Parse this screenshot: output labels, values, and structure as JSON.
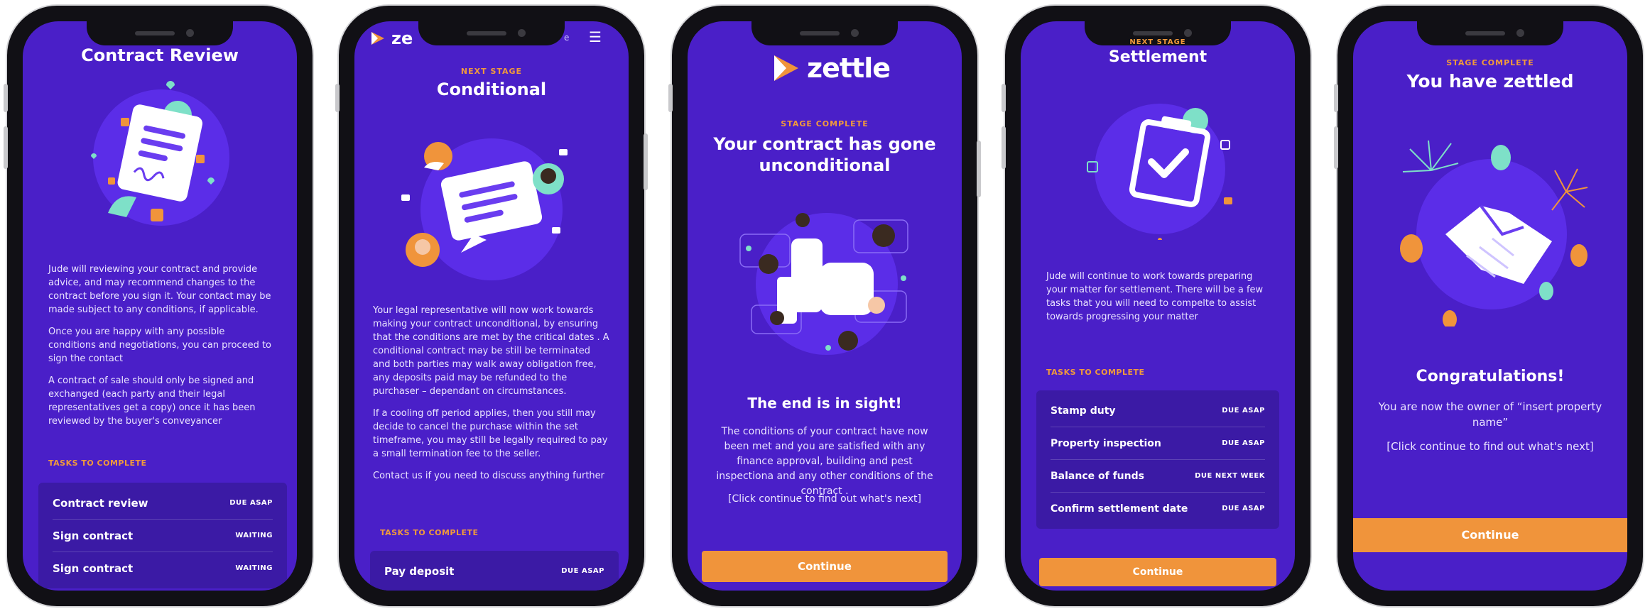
{
  "brand": {
    "name": "zettle",
    "orange": "#f0943b",
    "purple": "#4a1fc8",
    "menu_icon": "hamburger-icon"
  },
  "screens": [
    {
      "title": "Contract Review",
      "paragraphs": [
        "Jude will  reviewing your contract  and provide advice, and may recommend changes to the contract before you sign it. Your contact may be made subject to any conditions, if applicable.",
        "Once you are happy with any  possible conditions and negotiations, you can proceed to sign the contact",
        "A contract of sale should only be signed and exchanged (each party  and their legal representatives get a copy) once it has been reviewed by the buyer's  conveyancer"
      ],
      "tasks_label": "TASKS TO COMPLETE",
      "tasks": [
        {
          "name": "Contract review",
          "status": "DUE ASAP"
        },
        {
          "name": "Sign contract",
          "status": "WAITING"
        },
        {
          "name": "Sign contract",
          "status": "WAITING"
        }
      ]
    },
    {
      "header_partial_logo": "ze",
      "header_partial_text": "e",
      "eyebrow": "NEXT STAGE",
      "title": "Conditional",
      "paragraphs": [
        "Your legal representative will now work towards making your contract unconditional, by ensuring that the conditions are met by the critical dates . A conditional contract may be still be terminated and both parties may walk away obligation free, any deposits paid may be refunded to the purchaser – dependant on circumstances.",
        "If a cooling off period applies, then you still may decide to cancel the purchase within the set timeframe, you may still be legally required to pay a small termination fee to the seller.",
        "Contact us if you need to discuss anything further"
      ],
      "tasks_label": "TASKS TO COMPLETE",
      "tasks": [
        {
          "name": "Pay deposit",
          "status": "DUE ASAP"
        }
      ]
    },
    {
      "eyebrow": "STAGE COMPLETE",
      "title": "Your contract has gone unconditional",
      "subtitle": "The end is in sight!",
      "paragraph": "The conditions of your contract have now been met and you are satisfied with any finance approval, building and pest inspectiona and any other conditions of the contract .",
      "hint": "[Click continue to find out what's next]",
      "cta": "Continue"
    },
    {
      "eyebrow": "NEXT STAGE",
      "title": "Settlement",
      "paragraph": "Jude will continue to work towards preparing your matter for settlement. There will be a few tasks that you will need to compelte to assist towards progressing your matter",
      "tasks_label": "TASKS TO COMPLETE",
      "tasks": [
        {
          "name": "Stamp duty",
          "status": "DUE ASAP"
        },
        {
          "name": "Property inspection",
          "status": "DUE ASAP"
        },
        {
          "name": "Balance of funds",
          "status": "DUE NEXT WEEK"
        },
        {
          "name": "Confirm settlement date",
          "status": "DUE ASAP"
        }
      ],
      "cta": "Continue"
    },
    {
      "eyebrow": "STAGE COMPLETE",
      "title": "You have zettled",
      "subtitle": "Congratulations!",
      "paragraph": "You are now the owner of “insert property name”",
      "hint": "[Click continue to find out what's next]",
      "cta": "Continue"
    }
  ]
}
